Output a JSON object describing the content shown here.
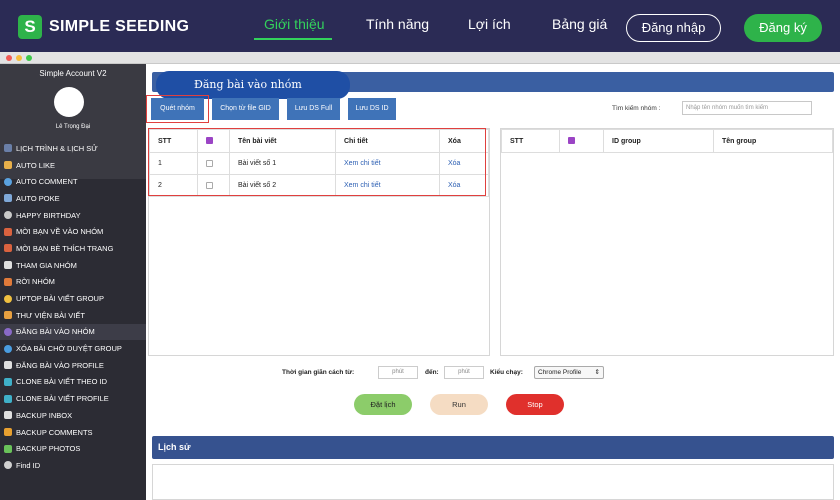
{
  "site": {
    "logo_letter": "S",
    "brand": "SIMPLE SEEDING",
    "nav": [
      "Giới thiệu",
      "Tính năng",
      "Lợi ích",
      "Bảng giá"
    ],
    "login": "Đăng nhập",
    "register": "Đăng ký",
    "colors": {
      "nav_bg": "#2b2b55",
      "accent_green": "#2eb34a"
    }
  },
  "app": {
    "account_title": "Simple Account V2",
    "user_name": "Lê Trọng Đại",
    "menu": [
      {
        "label": "LỊCH TRÌNH & LỊCH SỬ",
        "icon": "calendar-icon"
      },
      {
        "label": "AUTO LIKE",
        "icon": "thumbs-up-icon"
      },
      {
        "label": "AUTO COMMENT",
        "icon": "comment-icon"
      },
      {
        "label": "AUTO POKE",
        "icon": "poke-icon"
      },
      {
        "label": "HAPPY BIRTHDAY",
        "icon": "cake-icon"
      },
      {
        "label": "MỜI BẠN VỀ VÀO NHÓM",
        "icon": "plus-icon"
      },
      {
        "label": "MỜI BẠN BÈ THÍCH TRANG",
        "icon": "plus-icon"
      },
      {
        "label": "THAM GIA NHÓM",
        "icon": "group-icon"
      },
      {
        "label": "RỜI NHÓM",
        "icon": "leave-icon"
      },
      {
        "label": "UPTOP BÀI VIẾT GROUP",
        "icon": "arrow-up-icon"
      },
      {
        "label": "THƯ VIỆN BÀI VIẾT",
        "icon": "library-icon"
      },
      {
        "label": "ĐĂNG BÀI VÀO NHÓM",
        "icon": "post-icon",
        "active": true
      },
      {
        "label": "XÓA BÀI CHỜ DUYỆT GROUP",
        "icon": "delete-icon"
      },
      {
        "label": "ĐĂNG BÀI VÀO PROFILE",
        "icon": "profile-icon"
      },
      {
        "label": "CLONE BÀI VIẾT THEO ID",
        "icon": "clone-icon"
      },
      {
        "label": "CLONE BÀI VIẾT PROFILE",
        "icon": "clone-icon"
      },
      {
        "label": "BACKUP INBOX",
        "icon": "inbox-icon"
      },
      {
        "label": "BACKUP COMMENTS",
        "icon": "comments-backup-icon"
      },
      {
        "label": "BACKUP PHOTOS",
        "icon": "photos-icon"
      },
      {
        "label": "Find ID",
        "icon": "find-icon"
      }
    ],
    "section_title": "Đăng bài vào nhóm",
    "toolbar": {
      "scan": "Quét nhóm",
      "choose_file": "Chọn từ file GID",
      "save_full": "Lưu DS Full",
      "save_id": "Lưu DS ID"
    },
    "search": {
      "label": "Tìm kiếm nhóm :",
      "placeholder": "Nhập tên nhóm muốn tìm kiếm"
    },
    "left_table": {
      "headers": [
        "STT",
        "",
        "Tên bài viết",
        "Chi tiết",
        "Xóa"
      ],
      "rows": [
        {
          "stt": "1",
          "name": "Bài viết số 1",
          "detail": "Xem chi tiết",
          "delete": "Xóa"
        },
        {
          "stt": "2",
          "name": "Bài viết số 2",
          "detail": "Xem chi tiết",
          "delete": "Xóa"
        }
      ]
    },
    "right_table": {
      "headers": [
        "STT",
        "",
        "ID group",
        "Tên group"
      ]
    },
    "delay": {
      "label_from": "Thời gian giãn cách từ:",
      "from_placeholder": "phút",
      "label_to": "đến:",
      "to_placeholder": "phút",
      "run_mode_label": "Kiểu chạy:",
      "run_mode_value": "Chrome Profile"
    },
    "actions": {
      "schedule": "Đặt lịch",
      "run": "Run",
      "stop": "Stop"
    },
    "history_title": "Lịch sử"
  }
}
